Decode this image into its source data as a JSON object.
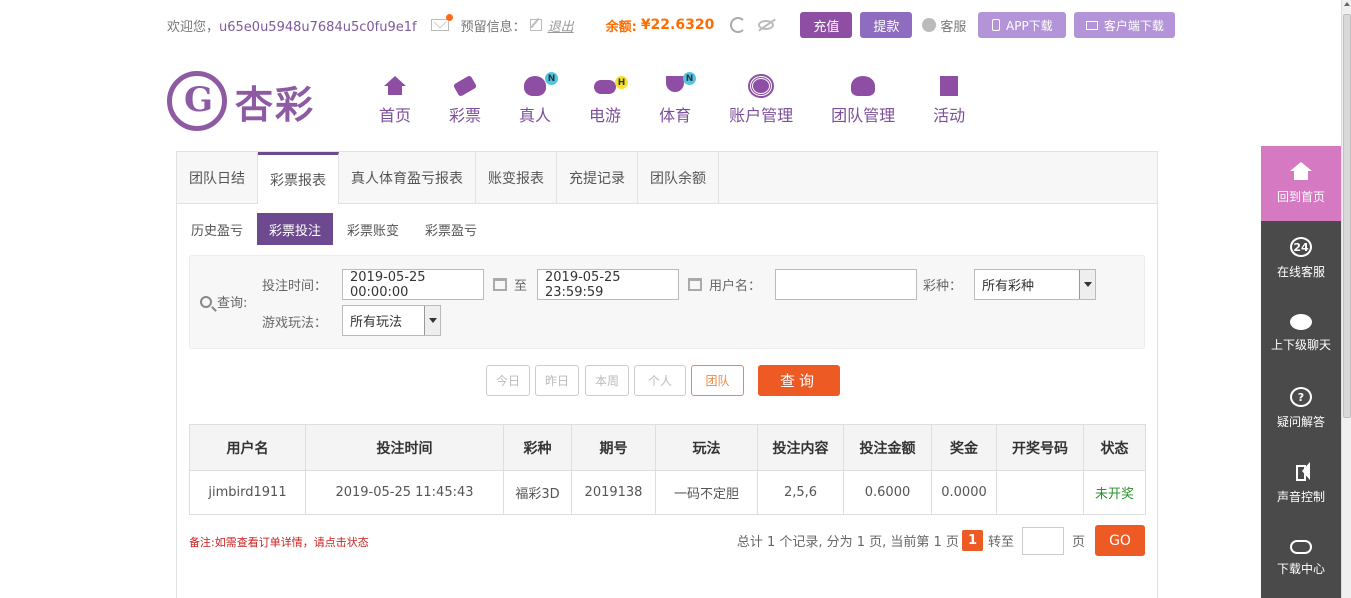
{
  "topbar": {
    "welcome": "欢迎您，",
    "username": "u65e0u5948u7684u5c0fu9e1f",
    "reserve_info": "预留信息：",
    "logout": "退出",
    "balance_label": "余额:",
    "balance_value": "¥22.6320",
    "recharge": "充值",
    "withdraw": "提款",
    "service": "客服",
    "app_download": "APP下载",
    "client_download": "客户端下载"
  },
  "logo": {
    "text": "杏彩"
  },
  "nav": [
    {
      "label": "首页",
      "icon": "home-icon"
    },
    {
      "label": "彩票",
      "icon": "ticket-icon"
    },
    {
      "label": "真人",
      "icon": "live-dealer-icon",
      "badge": "N"
    },
    {
      "label": "电游",
      "icon": "gamepad-icon",
      "badge": "H"
    },
    {
      "label": "体育",
      "icon": "trophy-icon",
      "badge": "N"
    },
    {
      "label": "账户管理",
      "icon": "account-icon"
    },
    {
      "label": "团队管理",
      "icon": "team-icon"
    },
    {
      "label": "活动",
      "icon": "gift-icon"
    }
  ],
  "tabs": [
    "团队日结",
    "彩票报表",
    "真人体育盈亏报表",
    "账变报表",
    "充提记录",
    "团队余额"
  ],
  "active_tab": "彩票报表",
  "subtabs": [
    "历史盈亏",
    "彩票投注",
    "彩票账变",
    "彩票盈亏"
  ],
  "active_subtab": "彩票投注",
  "query": {
    "label": "查询:",
    "bet_time_label": "投注时间：",
    "start_time": "2019-05-25 00:00:00",
    "to": "至",
    "end_time": "2019-05-25 23:59:59",
    "username_label": "用户名：",
    "username_value": "",
    "lottery_label": "彩种：",
    "lottery_value": "所有彩种",
    "play_label": "游戏玩法：",
    "play_value": "所有玩法"
  },
  "quick": {
    "today": "今日",
    "yesterday": "昨日",
    "week": "本周",
    "personal": "个人",
    "team": "团队",
    "search": "查询"
  },
  "table": {
    "headers": [
      "用户名",
      "投注时间",
      "彩种",
      "期号",
      "玩法",
      "投注内容",
      "投注金额",
      "奖金",
      "开奖号码",
      "状态"
    ],
    "rows": [
      [
        "jimbird1911",
        "2019-05-25 11:45:43",
        "福彩3D",
        "2019138",
        "一码不定胆",
        "2,5,6",
        "0.6000",
        "0.0000",
        "",
        "未开奖"
      ]
    ]
  },
  "note": "备注:如需查看订单详情，请点击状态",
  "pager": {
    "summary": "总计 1 个记录, 分为 1 页, 当前第 1 页",
    "current": "1",
    "goto": "转至",
    "page_unit": "页",
    "go": "GO"
  },
  "sidebar": [
    {
      "label": "回到首页",
      "icon": "home-icon"
    },
    {
      "label": "在线客服",
      "icon": "24h-service-icon",
      "glyph": "24"
    },
    {
      "label": "上下级聊天",
      "icon": "chat-icon"
    },
    {
      "label": "疑问解答",
      "icon": "question-icon",
      "glyph": "?"
    },
    {
      "label": "声音控制",
      "icon": "speaker-icon"
    },
    {
      "label": "下载中心",
      "icon": "cloud-download-icon"
    }
  ],
  "colors": {
    "brand": "#8e4ea3",
    "accent": "#ee5a24",
    "sidebar": "#4a4a4a",
    "sidebar_active": "#d679c3"
  }
}
